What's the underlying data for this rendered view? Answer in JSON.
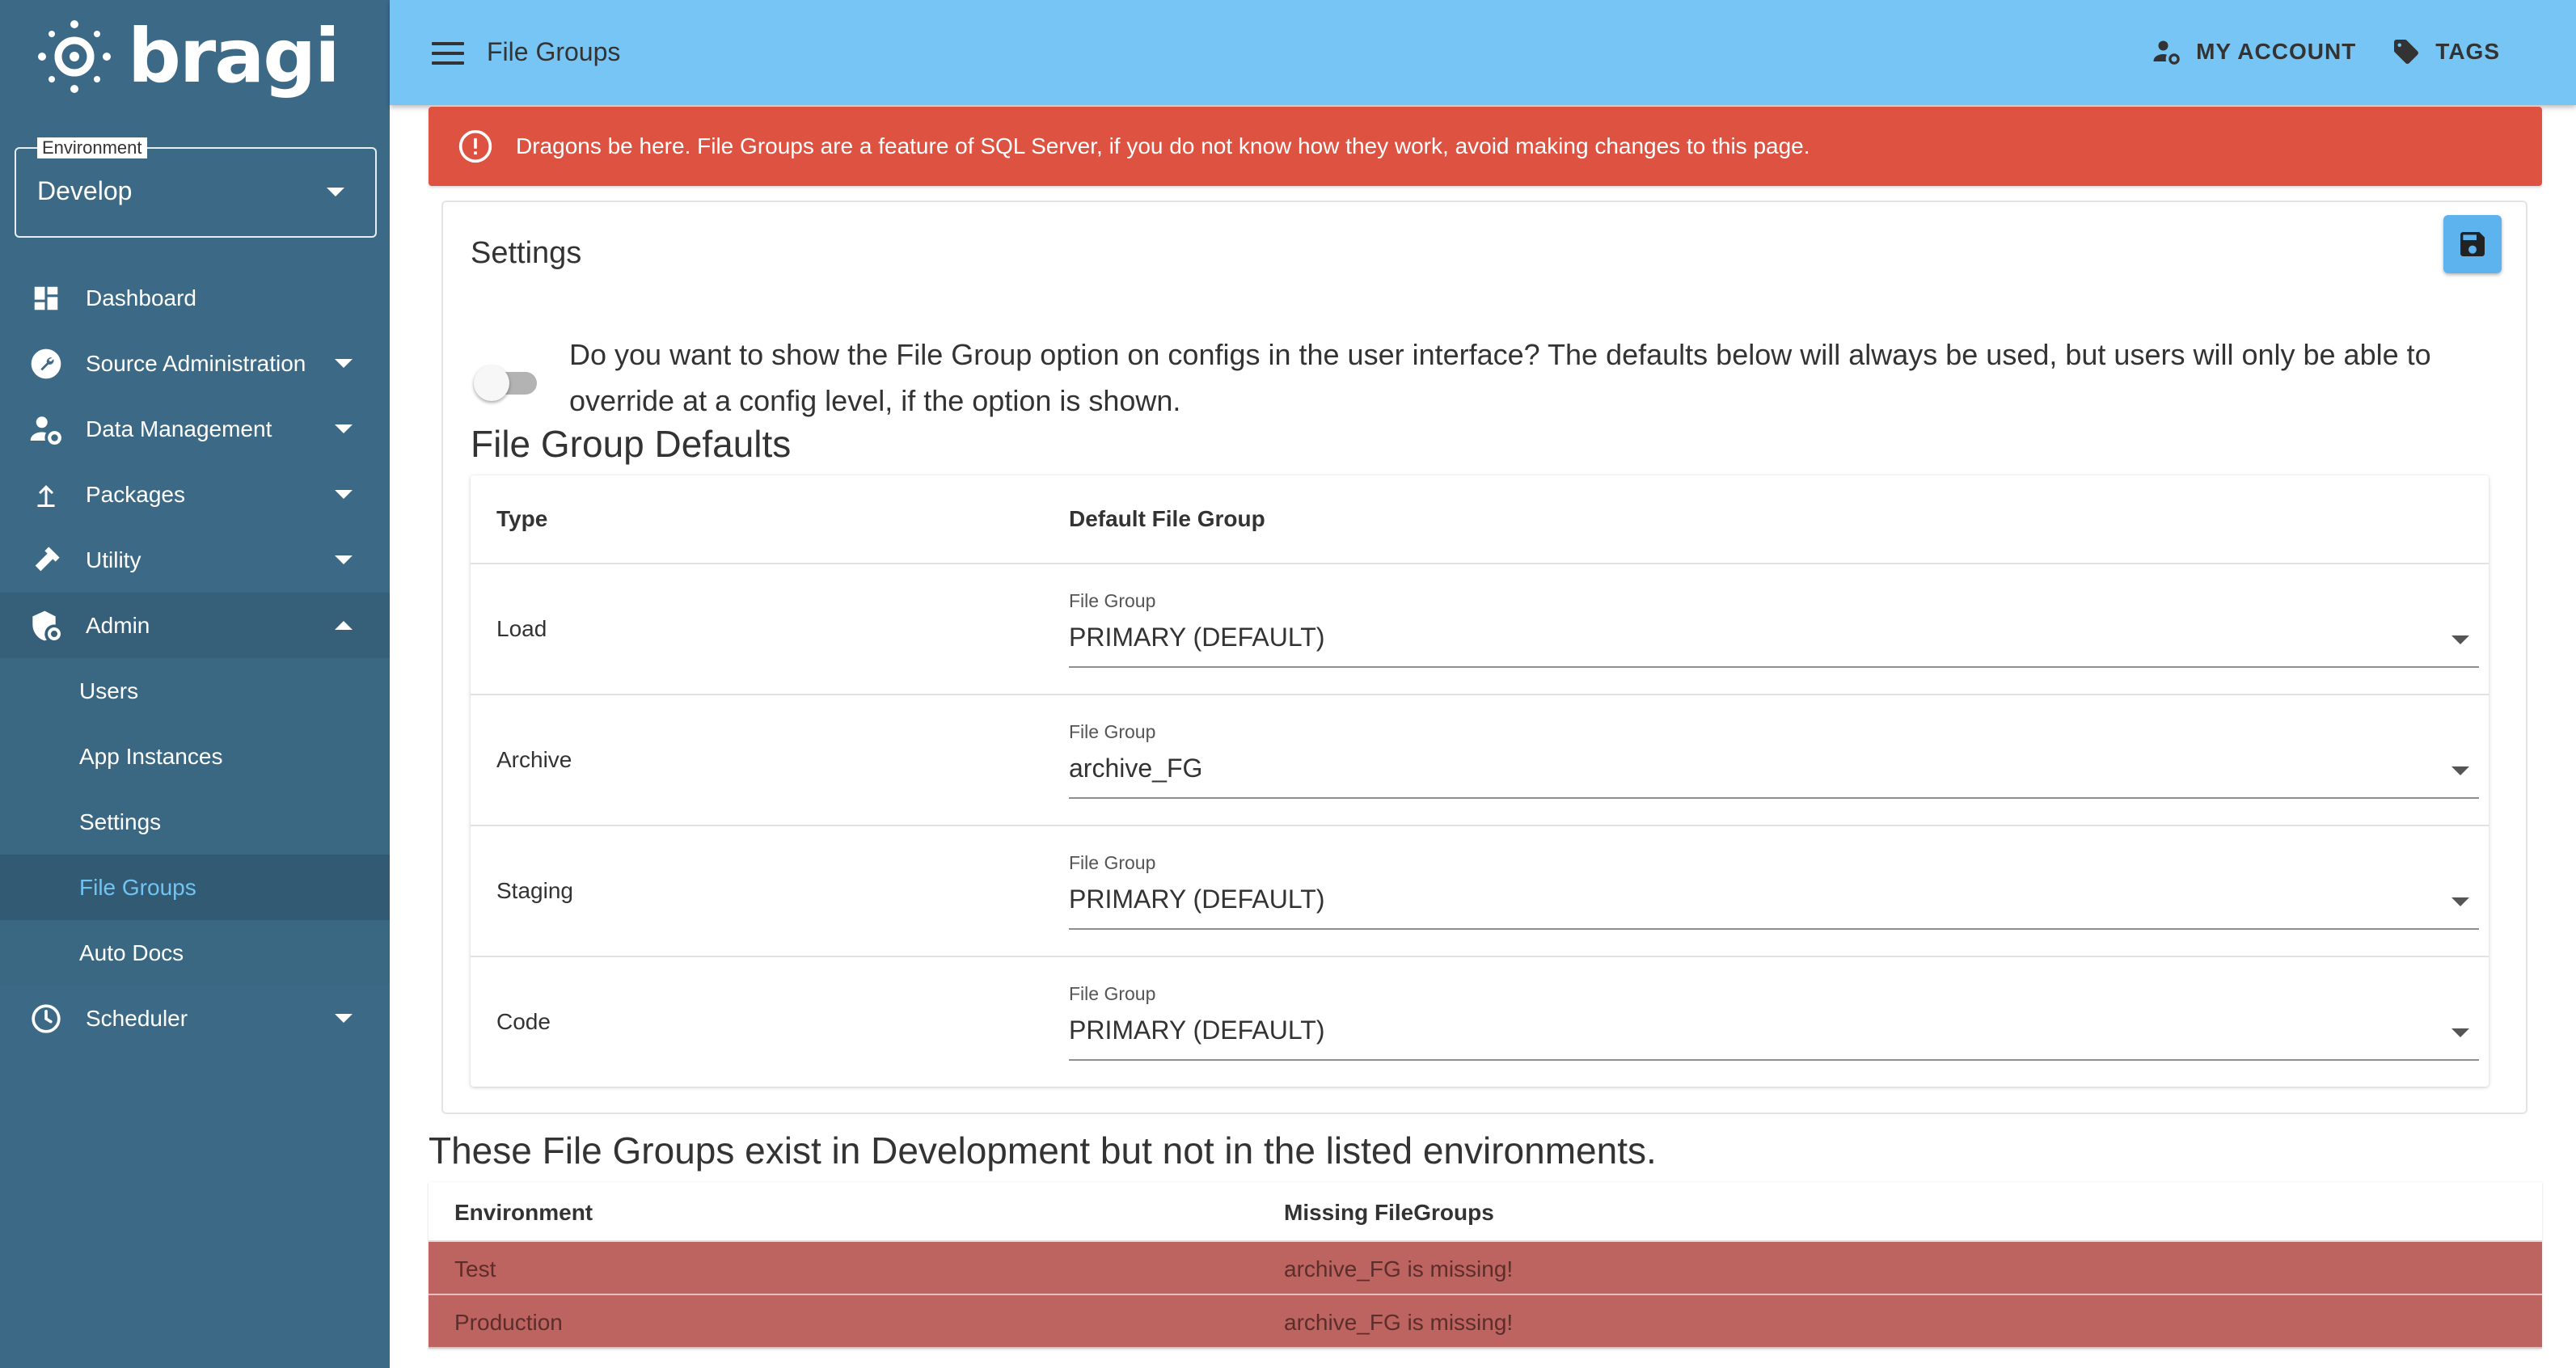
{
  "app": {
    "logo_text": "bragi"
  },
  "environment": {
    "label": "Environment",
    "value": "Develop"
  },
  "sidebar": {
    "items": [
      {
        "label": "Dashboard",
        "icon": "dashboard-icon"
      },
      {
        "label": "Source Administration",
        "icon": "wrench-icon"
      },
      {
        "label": "Data Management",
        "icon": "user-gear-icon"
      },
      {
        "label": "Packages",
        "icon": "upload-icon"
      },
      {
        "label": "Utility",
        "icon": "tools-icon"
      },
      {
        "label": "Admin",
        "icon": "shield-gear-icon"
      },
      {
        "label": "Scheduler",
        "icon": "clock-icon"
      }
    ],
    "admin_sub": [
      {
        "label": "Users"
      },
      {
        "label": "App Instances"
      },
      {
        "label": "Settings"
      },
      {
        "label": "File Groups",
        "active": true
      },
      {
        "label": "Auto Docs"
      }
    ]
  },
  "header": {
    "title": "File Groups",
    "my_account": "MY ACCOUNT",
    "tags": "TAGS"
  },
  "alert": {
    "text": "Dragons be here. File Groups are a feature of SQL Server, if you do not know how they work, avoid making changes to this page."
  },
  "settings": {
    "title": "Settings",
    "toggle_text": "Do you want to show the File Group option on configs in the user interface? The defaults below will always be used, but users will only be able to override at a config level, if the option is shown.",
    "toggle_on": false,
    "defaults_title": "File Group Defaults",
    "columns": [
      "Type",
      "Default File Group"
    ],
    "rows": [
      {
        "type": "Load",
        "field_label": "File Group",
        "value": "PRIMARY (DEFAULT)"
      },
      {
        "type": "Archive",
        "field_label": "File Group",
        "value": "archive_FG"
      },
      {
        "type": "Staging",
        "field_label": "File Group",
        "value": "PRIMARY (DEFAULT)"
      },
      {
        "type": "Code",
        "field_label": "File Group",
        "value": "PRIMARY (DEFAULT)"
      }
    ]
  },
  "missing": {
    "title": "These File Groups exist in Development but not in the listed environments.",
    "columns": [
      "Environment",
      "Missing FileGroups"
    ],
    "rows": [
      {
        "environment": "Test",
        "missing": "archive_FG is missing!"
      },
      {
        "environment": "Production",
        "missing": "archive_FG is missing!"
      }
    ]
  },
  "colors": {
    "sidebar": "#3c6a86",
    "topbar": "#76c5f5",
    "alert": "#de5241",
    "missing_row": "#bd6360",
    "active_link": "#6fc4f4"
  }
}
